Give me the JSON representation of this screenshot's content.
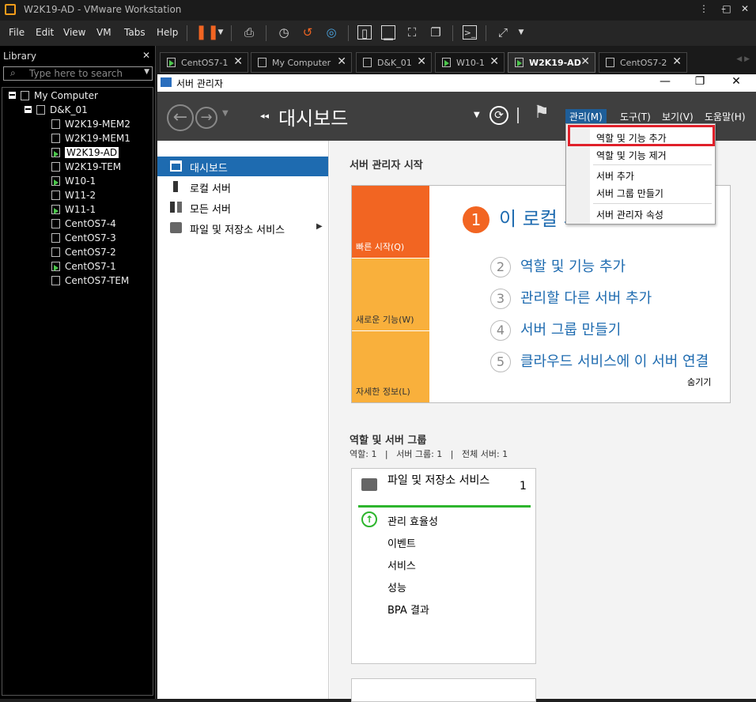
{
  "vmware": {
    "title": "W2K19-AD - VMware Workstation",
    "window_controls": [
      "⋮",
      "–",
      "□",
      "✕"
    ],
    "menus": [
      "File",
      "Edit",
      "View",
      "VM",
      "Tabs",
      "Help"
    ],
    "toolbar_icons": [
      "pause-icon",
      "dropdown-icon",
      "send-ctrl-alt-del-icon",
      "snapshot-icon",
      "revert-snapshot-icon",
      "snapshot-manager-icon",
      "library-view-icon",
      "thumbnail-view-icon",
      "fullscreen-icon",
      "unity-icon",
      "console-icon",
      "stretch-icon"
    ],
    "colors": {
      "accent": "#f49d1a",
      "running": "#4cc74c"
    }
  },
  "library": {
    "title": "Library",
    "close": "✕",
    "search_placeholder": "Type here to search",
    "tree": [
      {
        "label": "My Computer",
        "level": 0,
        "expander": true
      },
      {
        "label": "D&K_01",
        "level": 1,
        "expander": true
      },
      {
        "label": "W2K19-MEM2",
        "level": 2,
        "running": false
      },
      {
        "label": "W2K19-MEM1",
        "level": 2,
        "running": false
      },
      {
        "label": "W2K19-AD",
        "level": 2,
        "running": true,
        "selected": true
      },
      {
        "label": "W2K19-TEM",
        "level": 2,
        "running": false
      },
      {
        "label": "W10-1",
        "level": 2,
        "running": true
      },
      {
        "label": "W11-2",
        "level": 2,
        "running": false
      },
      {
        "label": "W11-1",
        "level": 2,
        "running": true
      },
      {
        "label": "CentOS7-4",
        "level": 2,
        "running": false
      },
      {
        "label": "CentOS7-3",
        "level": 2,
        "running": false
      },
      {
        "label": "CentOS7-2",
        "level": 2,
        "running": false
      },
      {
        "label": "CentOS7-1",
        "level": 2,
        "running": true
      },
      {
        "label": "CentOS7-TEM",
        "level": 2,
        "running": false
      }
    ]
  },
  "tabs": [
    {
      "label": "CentOS7-1",
      "active": false,
      "running": true
    },
    {
      "label": "My Computer",
      "active": false,
      "running": false
    },
    {
      "label": "D&K_01",
      "active": false,
      "running": false
    },
    {
      "label": "W10-1",
      "active": false,
      "running": true
    },
    {
      "label": "W2K19-AD",
      "active": true,
      "running": true
    },
    {
      "label": "CentOS7-2",
      "active": false,
      "running": false
    }
  ],
  "server_manager": {
    "title": "서버 관리자",
    "window_controls": [
      "—",
      "❐",
      "✕"
    ],
    "breadcrumb": "대시보드",
    "header_menus": [
      "관리(M)",
      "도구(T)",
      "보기(V)",
      "도움말(H)"
    ],
    "nav": [
      {
        "label": "대시보드",
        "icon": "dashboard-icon",
        "active": true
      },
      {
        "label": "로컬 서버",
        "icon": "local-server-icon",
        "active": false
      },
      {
        "label": "모든 서버",
        "icon": "all-servers-icon",
        "active": false
      },
      {
        "label": "파일 및 저장소 서비스",
        "icon": "file-storage-icon",
        "active": false
      }
    ],
    "quick_start": {
      "section_title": "서버 관리자 시작",
      "tiles": [
        "빠른 시작(Q)",
        "새로운 기능(W)",
        "자세한 정보(L)"
      ],
      "step1": "이 로컬 서버 구성",
      "steps": [
        {
          "num": "2",
          "label": "역할 및 기능 추가"
        },
        {
          "num": "3",
          "label": "관리할 다른 서버 추가"
        },
        {
          "num": "4",
          "label": "서버 그룹 만들기"
        },
        {
          "num": "5",
          "label": "클라우드 서비스에 이 서버 연결"
        }
      ],
      "hide": "숨기기"
    },
    "roles": {
      "section_title": "역할 및 서버 그룹",
      "summary": "역할: 1   |   서버 그룹: 1   |   전체 서버: 1",
      "card_title": "파일 및 저장소 서비스",
      "card_count": "1",
      "items": [
        "관리 효율성",
        "이벤트",
        "서비스",
        "성능",
        "BPA 결과"
      ]
    },
    "manage_menu": {
      "items": [
        "역할 및 기능 추가",
        "역할 및 기능 제거",
        "서버 추가",
        "서버 그룹 만들기",
        "서버 관리자 속성"
      ],
      "highlighted": "역할 및 기능 추가"
    },
    "colors": {
      "nav_active": "#1e6bb0",
      "orange": "#f26522",
      "tile_light": "#f9b03c",
      "highlight": "#e0202a",
      "link": "#1e6bb0"
    }
  }
}
